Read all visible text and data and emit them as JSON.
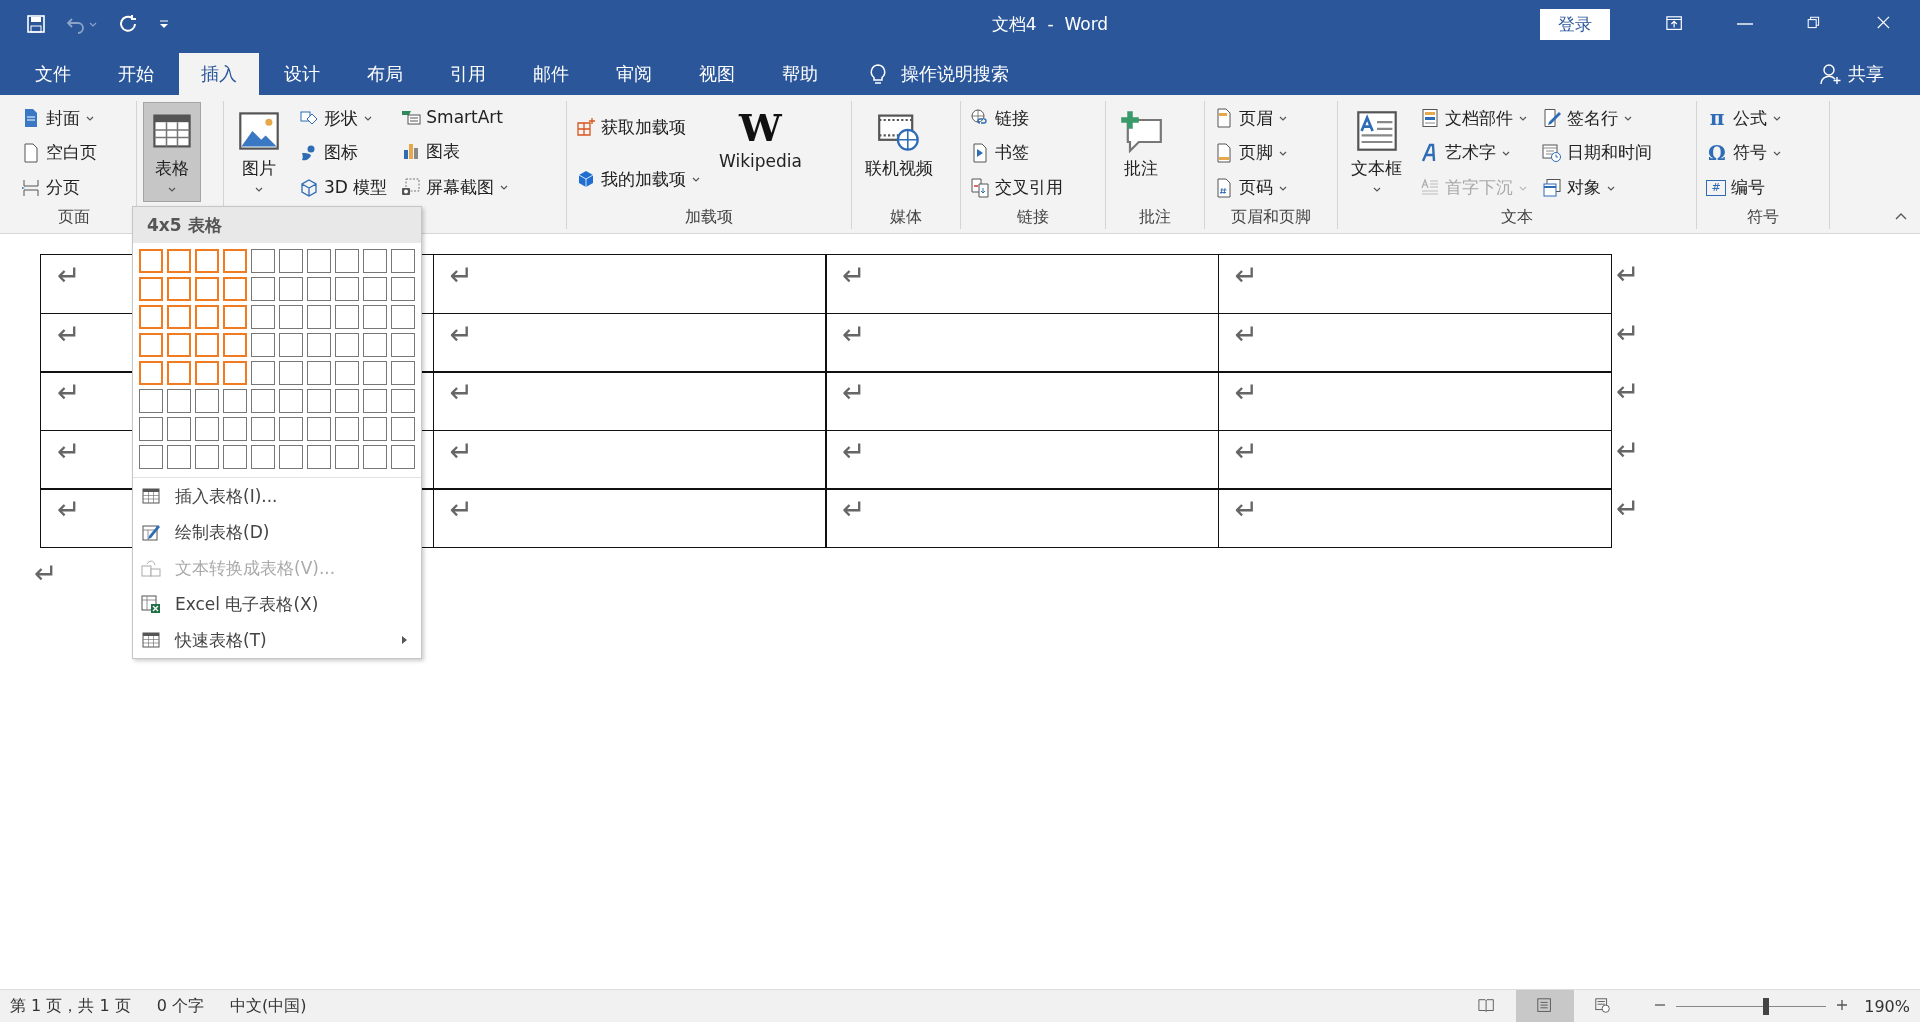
{
  "window": {
    "title": "文档4  -  Word",
    "sign_in": "登录"
  },
  "quick_access": [
    {
      "kind": "save",
      "disabled": false
    },
    {
      "kind": "undo",
      "disabled": true
    },
    {
      "kind": "repeat",
      "disabled": false
    },
    {
      "kind": "customize",
      "disabled": false
    }
  ],
  "tabs": [
    {
      "label": "文件",
      "selected": false
    },
    {
      "label": "开始",
      "selected": false
    },
    {
      "label": "插入",
      "selected": true
    },
    {
      "label": "设计",
      "selected": false
    },
    {
      "label": "布局",
      "selected": false
    },
    {
      "label": "引用",
      "selected": false
    },
    {
      "label": "邮件",
      "selected": false
    },
    {
      "label": "审阅",
      "selected": false
    },
    {
      "label": "视图",
      "selected": false
    },
    {
      "label": "帮助",
      "selected": false
    }
  ],
  "tell_me": "操作说明搜索",
  "share": "共享",
  "ribbon_groups": [
    {
      "label": "页面",
      "columns": [
        [
          {
            "kind": "small",
            "label": "封面",
            "dropdown": true
          },
          {
            "kind": "small",
            "label": "空白页",
            "dropdown": false
          },
          {
            "kind": "small",
            "label": "分页",
            "dropdown": false
          }
        ]
      ]
    },
    {
      "columns": [
        [
          {
            "kind": "large",
            "label": "表格",
            "dropdown": true,
            "pressed": true
          }
        ]
      ]
    },
    {
      "columns": [
        [
          {
            "kind": "large",
            "label": "图片",
            "dropdown": true,
            "pressed": false
          }
        ],
        [
          {
            "kind": "small",
            "label": "形状",
            "dropdown": true
          },
          {
            "kind": "small",
            "label": "图标",
            "dropdown": false
          },
          {
            "kind": "small",
            "label": "3D 模型",
            "dropdown": false
          }
        ],
        [
          {
            "kind": "small",
            "label": "SmartArt",
            "dropdown": false
          },
          {
            "kind": "small",
            "label": "图表",
            "dropdown": false
          },
          {
            "kind": "small",
            "label": "屏幕截图",
            "dropdown": true
          }
        ]
      ]
    },
    {
      "label": "加载项",
      "columns": [
        [
          {
            "kind": "small",
            "label": "获取加载项",
            "dropdown": false
          },
          {
            "kind": "small",
            "label": "我的加载项",
            "dropdown": true
          }
        ],
        [
          {
            "kind": "large",
            "label": "Wikipedia",
            "glyph": "W",
            "dropdown": false,
            "pressed": false
          }
        ]
      ]
    },
    {
      "label": "媒体",
      "columns": [
        [
          {
            "kind": "large",
            "label": "联机视频",
            "dropdown": false,
            "pressed": false
          }
        ]
      ]
    },
    {
      "label": "链接",
      "columns": [
        [
          {
            "kind": "small",
            "label": "链接",
            "dropdown": false
          },
          {
            "kind": "small",
            "label": "书签",
            "dropdown": false
          },
          {
            "kind": "small",
            "label": "交叉引用",
            "dropdown": false
          }
        ]
      ]
    },
    {
      "label": "批注",
      "columns": [
        [
          {
            "kind": "large",
            "label": "批注",
            "dropdown": false,
            "pressed": false
          }
        ]
      ]
    },
    {
      "label": "页眉和页脚",
      "columns": [
        [
          {
            "kind": "small",
            "label": "页眉",
            "dropdown": true
          },
          {
            "kind": "small",
            "label": "页脚",
            "dropdown": true
          },
          {
            "kind": "small",
            "label": "页码",
            "dropdown": true
          }
        ]
      ]
    },
    {
      "label": "文本",
      "columns": [
        [
          {
            "kind": "large",
            "label": "文本框",
            "dropdown": true,
            "pressed": false
          }
        ],
        [
          {
            "kind": "small",
            "label": "文档部件",
            "dropdown": true,
            "disabled": false
          },
          {
            "kind": "small",
            "label": "艺术字",
            "dropdown": true,
            "disabled": false
          },
          {
            "kind": "small",
            "label": "首字下沉",
            "dropdown": true,
            "disabled": true
          }
        ],
        [
          {
            "kind": "small",
            "label": "签名行",
            "dropdown": true
          },
          {
            "kind": "small",
            "label": "日期和时间",
            "dropdown": false
          },
          {
            "kind": "small",
            "label": "对象",
            "dropdown": true
          }
        ]
      ]
    },
    {
      "label": "符号",
      "columns": [
        [
          {
            "kind": "small",
            "label": "公式",
            "glyph": "π",
            "dropdown": true
          },
          {
            "kind": "small",
            "label": "符号",
            "glyph": "Ω",
            "dropdown": true
          },
          {
            "kind": "small",
            "label": "编号",
            "glyph": "#",
            "dropdown": false
          }
        ]
      ]
    }
  ],
  "table_menu": {
    "header": "4x5 表格",
    "grid_rows": [
      {
        "cells": [
          {
            "selected": true
          },
          {
            "selected": true
          },
          {
            "selected": true
          },
          {
            "selected": true
          },
          {
            "selected": false
          },
          {
            "selected": false
          },
          {
            "selected": false
          },
          {
            "selected": false
          },
          {
            "selected": false
          },
          {
            "selected": false
          }
        ]
      },
      {
        "cells": [
          {
            "selected": true
          },
          {
            "selected": true
          },
          {
            "selected": true
          },
          {
            "selected": true
          },
          {
            "selected": false
          },
          {
            "selected": false
          },
          {
            "selected": false
          },
          {
            "selected": false
          },
          {
            "selected": false
          },
          {
            "selected": false
          }
        ]
      },
      {
        "cells": [
          {
            "selected": true
          },
          {
            "selected": true
          },
          {
            "selected": true
          },
          {
            "selected": true
          },
          {
            "selected": false
          },
          {
            "selected": false
          },
          {
            "selected": false
          },
          {
            "selected": false
          },
          {
            "selected": false
          },
          {
            "selected": false
          }
        ]
      },
      {
        "cells": [
          {
            "selected": true
          },
          {
            "selected": true
          },
          {
            "selected": true
          },
          {
            "selected": true
          },
          {
            "selected": false
          },
          {
            "selected": false
          },
          {
            "selected": false
          },
          {
            "selected": false
          },
          {
            "selected": false
          },
          {
            "selected": false
          }
        ]
      },
      {
        "cells": [
          {
            "selected": true
          },
          {
            "selected": true
          },
          {
            "selected": true
          },
          {
            "selected": true
          },
          {
            "selected": false
          },
          {
            "selected": false
          },
          {
            "selected": false
          },
          {
            "selected": false
          },
          {
            "selected": false
          },
          {
            "selected": false
          }
        ]
      },
      {
        "cells": [
          {
            "selected": false
          },
          {
            "selected": false
          },
          {
            "selected": false
          },
          {
            "selected": false
          },
          {
            "selected": false
          },
          {
            "selected": false
          },
          {
            "selected": false
          },
          {
            "selected": false
          },
          {
            "selected": false
          },
          {
            "selected": false
          }
        ]
      },
      {
        "cells": [
          {
            "selected": false
          },
          {
            "selected": false
          },
          {
            "selected": false
          },
          {
            "selected": false
          },
          {
            "selected": false
          },
          {
            "selected": false
          },
          {
            "selected": false
          },
          {
            "selected": false
          },
          {
            "selected": false
          },
          {
            "selected": false
          }
        ]
      },
      {
        "cells": [
          {
            "selected": false
          },
          {
            "selected": false
          },
          {
            "selected": false
          },
          {
            "selected": false
          },
          {
            "selected": false
          },
          {
            "selected": false
          },
          {
            "selected": false
          },
          {
            "selected": false
          },
          {
            "selected": false
          },
          {
            "selected": false
          }
        ]
      }
    ],
    "items": [
      {
        "kind": "insert",
        "label": "插入表格(I)...",
        "disabled": false,
        "submenu": false
      },
      {
        "kind": "draw",
        "label": "绘制表格(D)",
        "disabled": false,
        "submenu": false
      },
      {
        "kind": "convert",
        "label": "文本转换成表格(V)...",
        "disabled": true,
        "submenu": false
      },
      {
        "kind": "excel",
        "label": "Excel 电子表格(X)",
        "disabled": false,
        "submenu": false
      },
      {
        "kind": "quick",
        "label": "快速表格(T)",
        "disabled": false,
        "submenu": true
      }
    ]
  },
  "document": {
    "table_rows": [
      {
        "cells": [
          "↵",
          "↵",
          "↵",
          "↵"
        ],
        "row_end": "↵"
      },
      {
        "cells": [
          "↵",
          "↵",
          "↵",
          "↵"
        ],
        "row_end": "↵"
      },
      {
        "cells": [
          "↵",
          "↵",
          "↵",
          "↵"
        ],
        "row_end": "↵"
      },
      {
        "cells": [
          "↵",
          "↵",
          "↵",
          "↵"
        ],
        "row_end": "↵"
      },
      {
        "cells": [
          "↵",
          "↵",
          "↵",
          "↵"
        ],
        "row_end": "↵"
      }
    ],
    "after_table": "↵"
  },
  "status_bar": {
    "items": [
      "第 1 页，共 1 页",
      "0 个字",
      "中文(中国)"
    ],
    "views": [
      {
        "kind": "read",
        "selected": false
      },
      {
        "kind": "print",
        "selected": true
      },
      {
        "kind": "web",
        "selected": false
      }
    ],
    "zoom": {
      "level": 0.6,
      "reading": "190%"
    }
  }
}
